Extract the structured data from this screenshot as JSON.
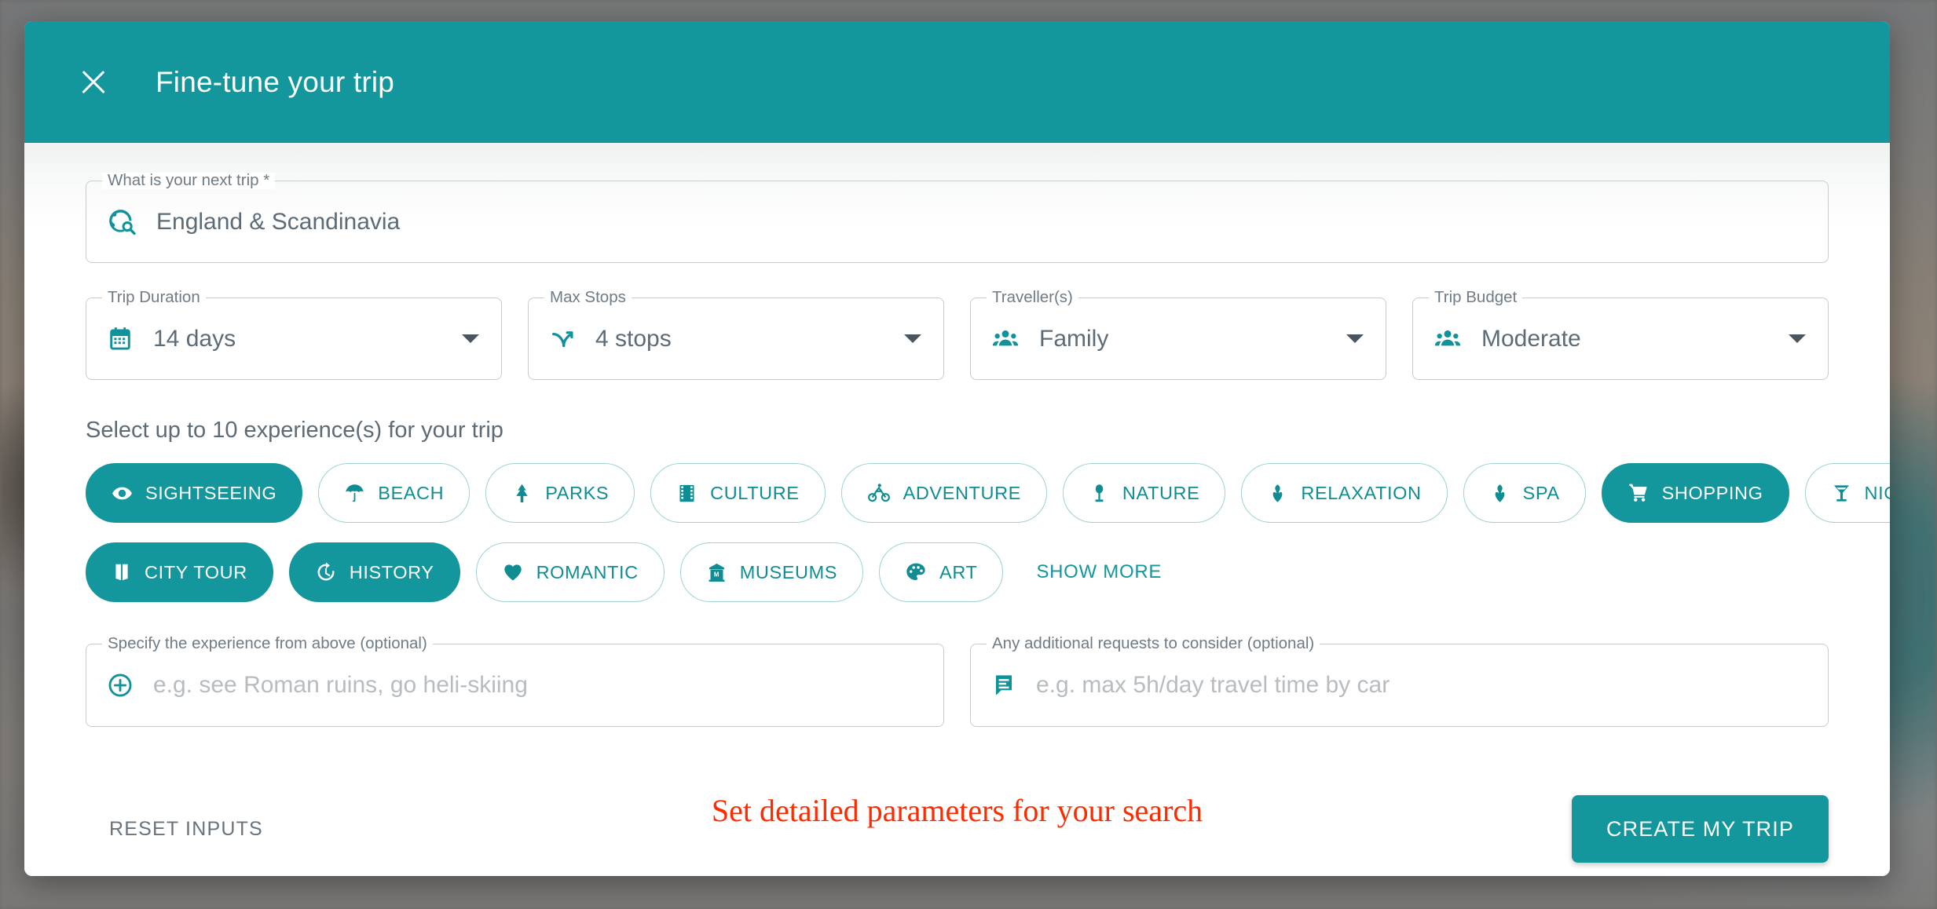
{
  "theme": {
    "accent": "#13969c",
    "accent_light": "#9ed2d4",
    "text_muted": "#5d6b77",
    "annotation_color": "#ff2b00"
  },
  "header": {
    "title": "Fine-tune your trip",
    "close_icon": "close-icon"
  },
  "destination": {
    "label": "What is your next trip *",
    "value": "England & Scandinavia",
    "icon": "globe-search-icon"
  },
  "dropdowns": [
    {
      "label": "Trip Duration",
      "value": "14 days",
      "icon": "calendar-icon"
    },
    {
      "label": "Max Stops",
      "value": "4 stops",
      "icon": "route-branch-icon"
    },
    {
      "label": "Traveller(s)",
      "value": "Family",
      "icon": "people-group-icon"
    },
    {
      "label": "Trip Budget",
      "value": "Moderate",
      "icon": "people-group-icon"
    }
  ],
  "experiences": {
    "heading": "Select up to 10 experience(s) for your trip",
    "show_more_label": "SHOW MORE",
    "row1": [
      {
        "label": "SIGHTSEEING",
        "icon": "eye-icon",
        "selected": true
      },
      {
        "label": "BEACH",
        "icon": "umbrella-icon",
        "selected": false
      },
      {
        "label": "PARKS",
        "icon": "tree-icon",
        "selected": false
      },
      {
        "label": "CULTURE",
        "icon": "film-icon",
        "selected": false
      },
      {
        "label": "ADVENTURE",
        "icon": "bicycle-icon",
        "selected": false
      },
      {
        "label": "NATURE",
        "icon": "plant-pot-icon",
        "selected": false
      },
      {
        "label": "RELAXATION",
        "icon": "spa-leaf-icon",
        "selected": false
      },
      {
        "label": "SPA",
        "icon": "spa-leaf-icon",
        "selected": false
      },
      {
        "label": "SHOPPING",
        "icon": "cart-icon",
        "selected": true
      },
      {
        "label": "NIGHTLIFE",
        "icon": "cocktail-icon",
        "selected": false
      }
    ],
    "row2": [
      {
        "label": "CITY TOUR",
        "icon": "book-open-icon",
        "selected": true
      },
      {
        "label": "HISTORY",
        "icon": "history-icon",
        "selected": true
      },
      {
        "label": "ROMANTIC",
        "icon": "heart-icon",
        "selected": false
      },
      {
        "label": "MUSEUMS",
        "icon": "museum-icon",
        "selected": false
      },
      {
        "label": "ART",
        "icon": "palette-icon",
        "selected": false
      }
    ]
  },
  "optional_fields": [
    {
      "label": "Specify the experience from above (optional)",
      "placeholder": "e.g. see Roman ruins, go heli-skiing",
      "value": "",
      "icon": "plus-circle-icon"
    },
    {
      "label": "Any additional requests to consider (optional)",
      "placeholder": "e.g. max 5h/day travel time by car",
      "value": "",
      "icon": "message-icon"
    }
  ],
  "footer": {
    "reset_label": "RESET INPUTS",
    "annotation": "Set detailed parameters for your search",
    "submit_label": "CREATE MY TRIP"
  }
}
